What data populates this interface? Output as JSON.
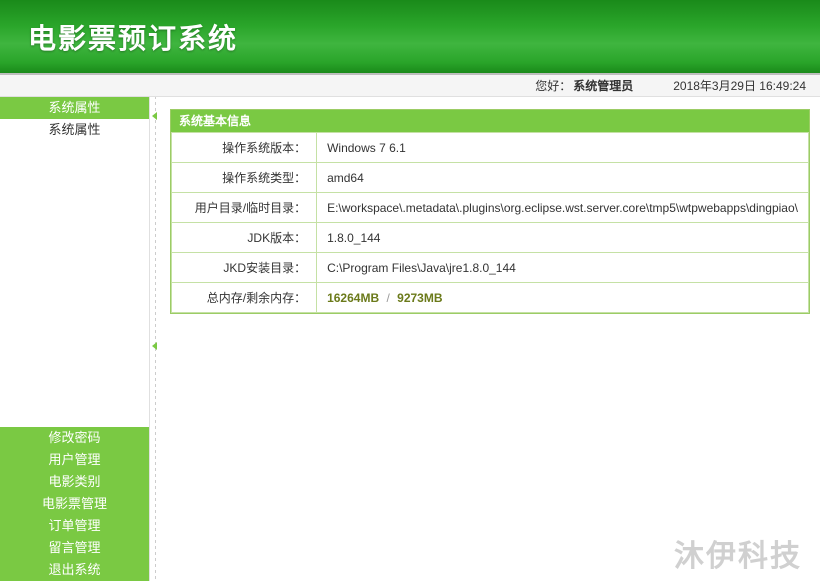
{
  "header": {
    "title": "电影票预订系统"
  },
  "topbar": {
    "greet_label": "您好：",
    "username": "系统管理员",
    "datetime": "2018年3月29日 16:49:24"
  },
  "sidebar": {
    "top_active": "系统属性",
    "top_item": "系统属性",
    "bottom_menu": [
      "修改密码",
      "用户管理",
      "电影类别",
      "电影票管理",
      "订单管理",
      "留言管理",
      "退出系统"
    ]
  },
  "panel": {
    "title": "系统基本信息"
  },
  "info_rows": {
    "os_version": {
      "label": "操作系统版本：",
      "value": "Windows 7  6.1"
    },
    "os_arch": {
      "label": "操作系统类型：",
      "value": "amd64"
    },
    "user_dir": {
      "label": "用户目录/临时目录：",
      "value": "E:\\workspace\\.metadata\\.plugins\\org.eclipse.wst.server.core\\tmp5\\wtpwebapps\\dingpiao\\"
    },
    "jdk_version": {
      "label": "JDK版本：",
      "value": "1.8.0_144"
    },
    "jdk_home": {
      "label": "JKD安装目录：",
      "value": "C:\\Program Files\\Java\\jre1.8.0_144"
    },
    "memory": {
      "label": "总内存/剩余内存：",
      "total": "16264MB",
      "sep": "/",
      "free": "9273MB"
    }
  },
  "watermark": "沐伊科技"
}
